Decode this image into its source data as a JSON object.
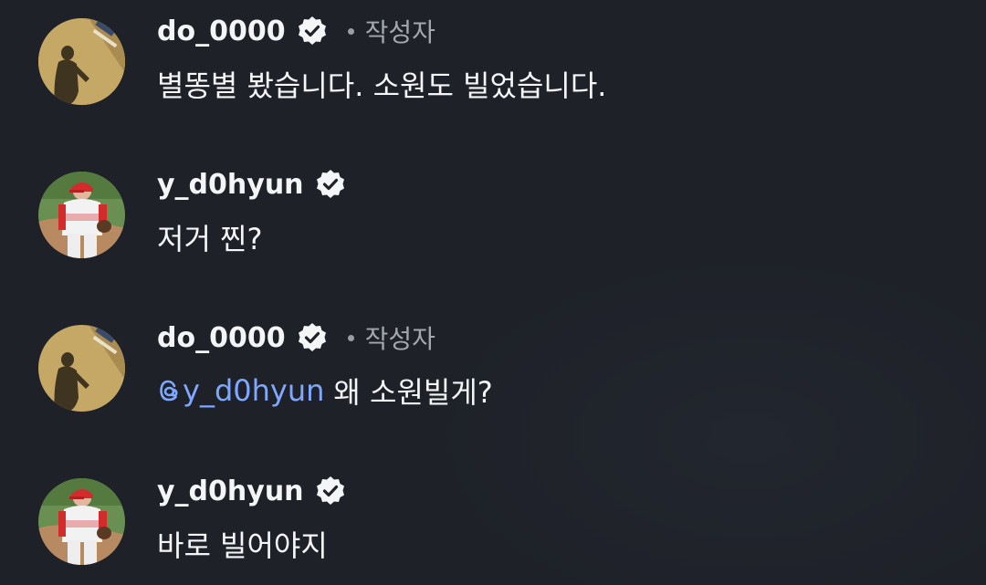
{
  "comments": [
    {
      "username": "do_0000",
      "author_tag": "작성자",
      "text": "별똥별 봤습니다. 소원도 빌었습니다."
    },
    {
      "username": "y_d0hyun",
      "text": "저거 찐?"
    },
    {
      "username": "do_0000",
      "author_tag": "작성자",
      "mention": "y_d0hyun",
      "text": "왜 소원빌게?"
    },
    {
      "username": "y_d0hyun",
      "text": "바로 빌어야지"
    }
  ],
  "colors": {
    "background": "#1e2128",
    "text": "#f5f6f8",
    "secondary_text": "#a3a7ae",
    "mention": "#7fa8ff"
  }
}
